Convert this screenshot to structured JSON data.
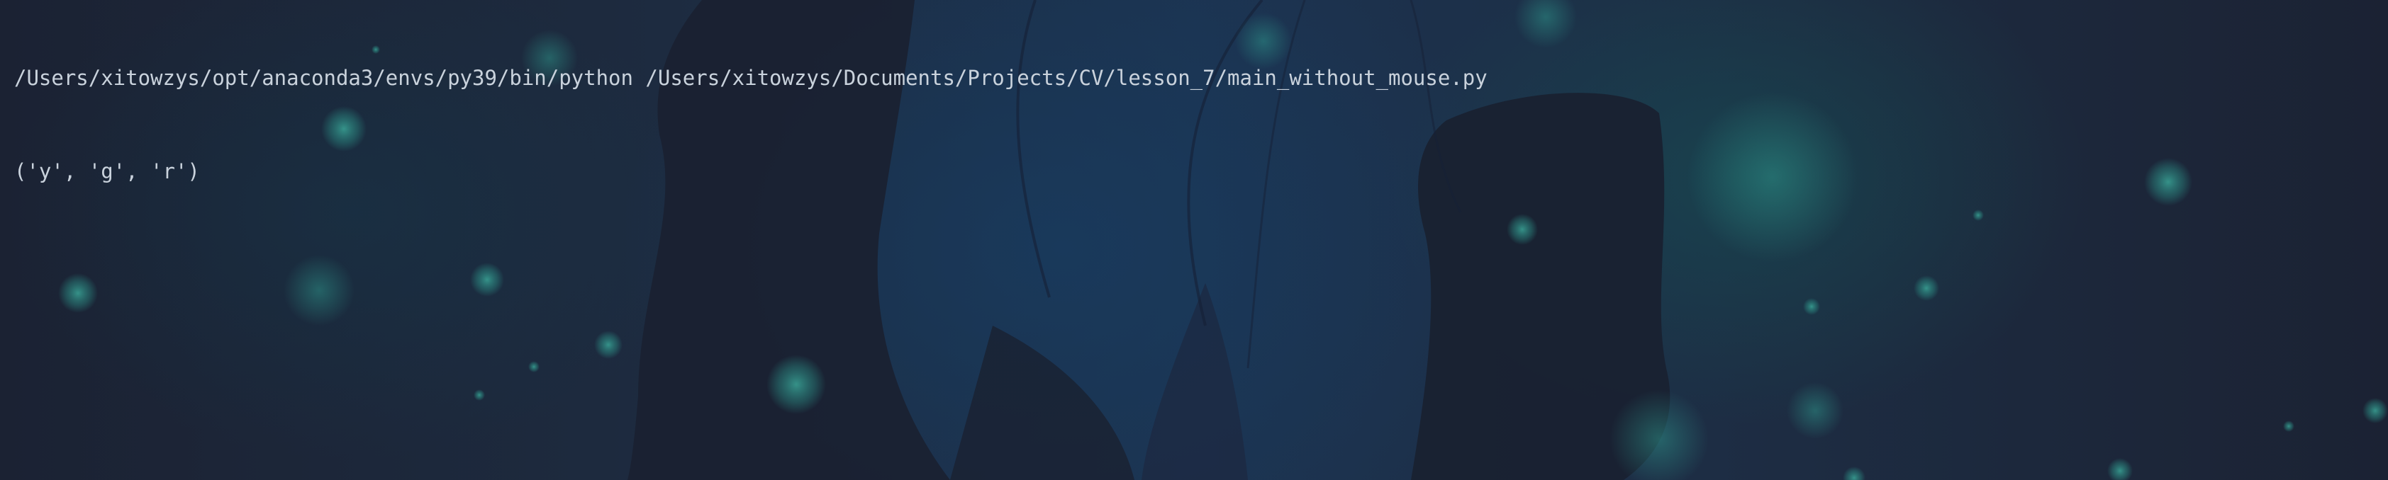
{
  "terminal": {
    "lines": [
      "/Users/xitowzys/opt/anaconda3/envs/py39/bin/python /Users/xitowzys/Documents/Projects/CV/lesson_7/main_without_mouse.py",
      "('y', 'g', 'r')"
    ]
  },
  "theme": {
    "background": "#1c2435",
    "text_color": "#c9d2dc",
    "accent_glow": "#2e8f8a"
  }
}
